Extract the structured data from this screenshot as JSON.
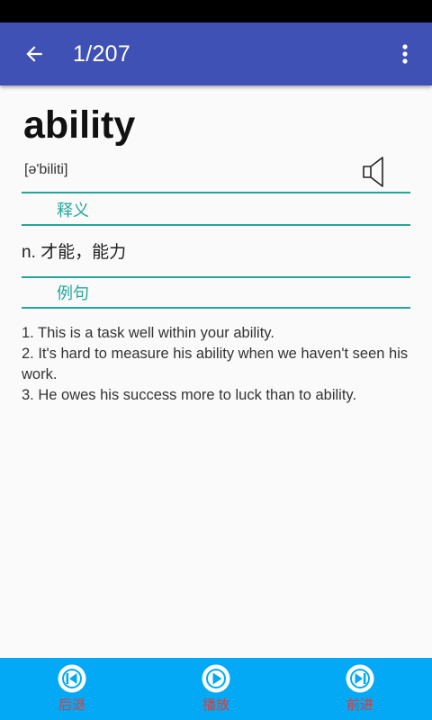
{
  "app_bar": {
    "title": "1/207",
    "back_icon": "arrow-back-icon",
    "menu_icon": "more-vert-icon",
    "color": "#3f51b5"
  },
  "entry": {
    "word": "ability",
    "phonetic": "[ə'biliti]",
    "speaker_icon": "speaker-icon",
    "definition_heading": "释义",
    "definition": "n. 才能，能力",
    "examples_heading": "例句",
    "examples": [
      "1. This is a task well within your ability.",
      "2. It's hard to measure his ability when we haven't seen his work.",
      "3. He owes his success more to luck than to ability."
    ],
    "accent_color": "#26a69a"
  },
  "bottom_bar": {
    "color": "#03a9f4",
    "buttons": [
      {
        "label": "后退",
        "icon": "skip-previous-icon"
      },
      {
        "label": "播放",
        "icon": "play-icon"
      },
      {
        "label": "前进",
        "icon": "skip-next-icon"
      }
    ]
  }
}
